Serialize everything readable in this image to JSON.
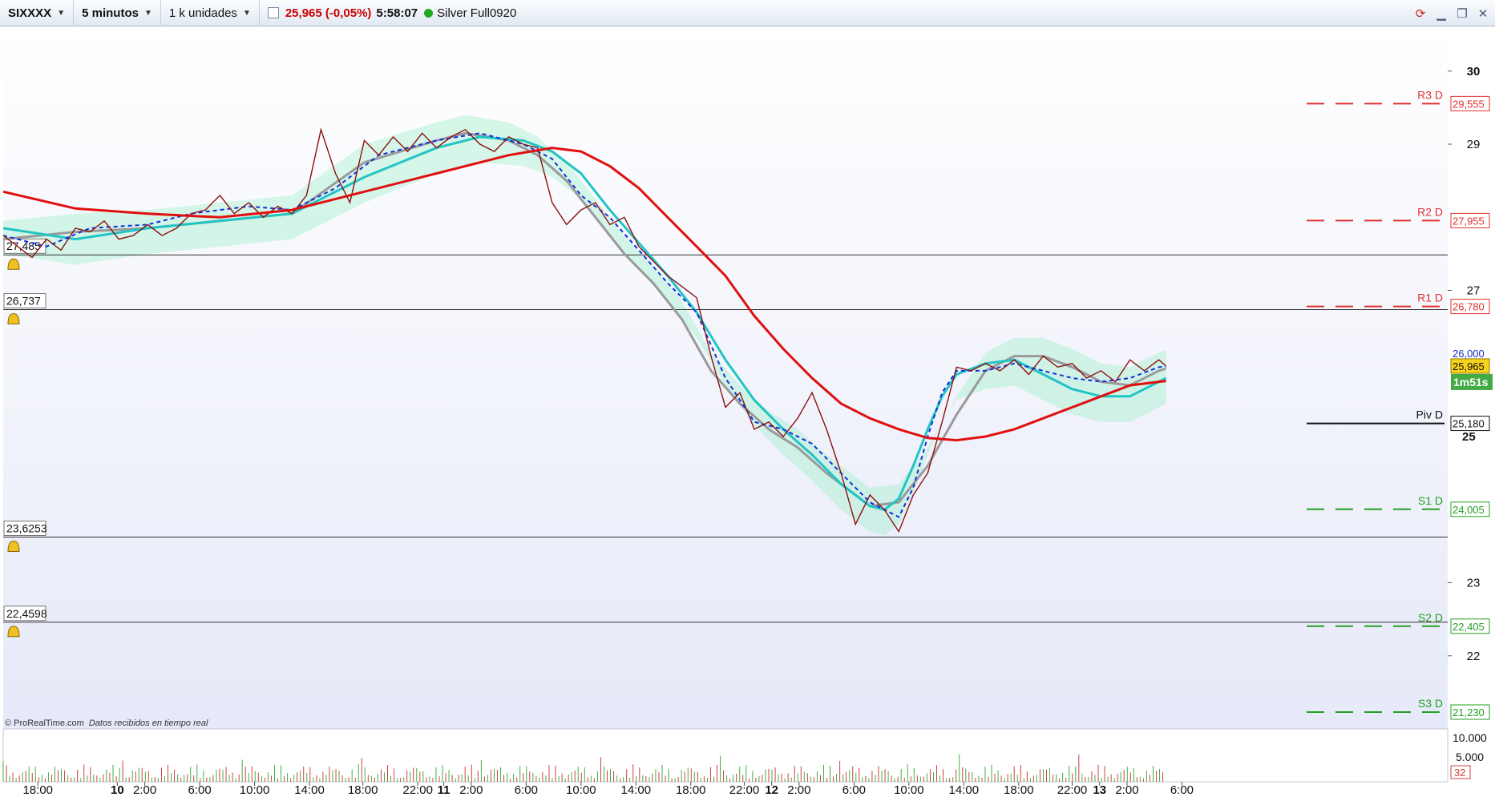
{
  "toolbar": {
    "instrument": "SIXXXX",
    "timeframe": "5 minutos",
    "quantity": "1 k unidades",
    "last_price": "25,965 (-0,05%)",
    "clock": "5:58:07",
    "account": "Silver Full0920"
  },
  "copyright": {
    "brand": "© ProRealTime.com",
    "note": "Datos recibidos en tiempo real"
  },
  "colors": {
    "price": "#8b1010",
    "ma_long": "#e01010",
    "ma_gray": "#9a9a9a",
    "ma_cyan": "#22c4c4",
    "kijun_blue": "#1030e0",
    "cloud": "#90eec0",
    "resistance": "#e03030",
    "support": "#22a022"
  },
  "price_axis": {
    "ticks": [
      "30",
      "29",
      "27",
      "23",
      "22"
    ],
    "bold_tick": "25",
    "range": [
      21.0,
      30.6
    ]
  },
  "horizontal_lines": [
    {
      "label": "27,485",
      "value": 27.485
    },
    {
      "label": "26,737",
      "value": 26.737
    },
    {
      "label": "23,6253",
      "value": 23.6253
    },
    {
      "label": "22,4598",
      "value": 22.4598
    }
  ],
  "pivots": [
    {
      "name": "R3 D",
      "label": "29,555",
      "value": 29.555,
      "kind": "resistance"
    },
    {
      "name": "R2 D",
      "label": "27,955",
      "value": 27.955,
      "kind": "resistance"
    },
    {
      "name": "R1 D",
      "label": "26,780",
      "value": 26.78,
      "kind": "resistance"
    },
    {
      "name": "Piv D",
      "label": "25,180",
      "value": 25.18,
      "kind": "pivot"
    },
    {
      "name": "S1 D",
      "label": "24,005",
      "value": 24.005,
      "kind": "support"
    },
    {
      "name": "S2 D",
      "label": "22,405",
      "value": 22.405,
      "kind": "support"
    },
    {
      "name": "S3 D",
      "label": "21,230",
      "value": 21.23,
      "kind": "support"
    }
  ],
  "last_price_tag": "25,965",
  "countdown_tag": "1m51s",
  "partial_tag": "26,000",
  "volume_axis": {
    "ticks": [
      "10.000",
      "5.000"
    ],
    "last_volume": "32"
  },
  "time_axis": [
    {
      "label": "18:00",
      "bold": false,
      "t": 0.024
    },
    {
      "label": "10",
      "bold": true,
      "t": 0.079
    },
    {
      "label": "2:00",
      "bold": false,
      "t": 0.098
    },
    {
      "label": "6:00",
      "bold": false,
      "t": 0.136
    },
    {
      "label": "10:00",
      "bold": false,
      "t": 0.174
    },
    {
      "label": "14:00",
      "bold": false,
      "t": 0.212
    },
    {
      "label": "18:00",
      "bold": false,
      "t": 0.249
    },
    {
      "label": "22:00",
      "bold": false,
      "t": 0.287
    },
    {
      "label": "11",
      "bold": true,
      "t": 0.305
    },
    {
      "label": "2:00",
      "bold": false,
      "t": 0.324
    },
    {
      "label": "6:00",
      "bold": false,
      "t": 0.362
    },
    {
      "label": "10:00",
      "bold": false,
      "t": 0.4
    },
    {
      "label": "14:00",
      "bold": false,
      "t": 0.438
    },
    {
      "label": "18:00",
      "bold": false,
      "t": 0.476
    },
    {
      "label": "22:00",
      "bold": false,
      "t": 0.513
    },
    {
      "label": "12",
      "bold": true,
      "t": 0.532
    },
    {
      "label": "2:00",
      "bold": false,
      "t": 0.551
    },
    {
      "label": "6:00",
      "bold": false,
      "t": 0.589
    },
    {
      "label": "10:00",
      "bold": false,
      "t": 0.627
    },
    {
      "label": "14:00",
      "bold": false,
      "t": 0.665
    },
    {
      "label": "18:00",
      "bold": false,
      "t": 0.703
    },
    {
      "label": "22:00",
      "bold": false,
      "t": 0.74
    },
    {
      "label": "13",
      "bold": true,
      "t": 0.759
    },
    {
      "label": "2:00",
      "bold": false,
      "t": 0.778
    },
    {
      "label": "6:00",
      "bold": false,
      "t": 0.816
    }
  ],
  "chart_data": {
    "type": "line",
    "series": [
      {
        "values": [
          [
            0.0,
            27.75
          ],
          [
            0.01,
            27.6
          ],
          [
            0.02,
            27.45
          ],
          [
            0.03,
            27.7
          ],
          [
            0.04,
            27.55
          ],
          [
            0.05,
            27.85
          ],
          [
            0.06,
            27.8
          ],
          [
            0.07,
            27.95
          ],
          [
            0.08,
            27.7
          ],
          [
            0.09,
            27.75
          ],
          [
            0.1,
            27.9
          ],
          [
            0.11,
            27.75
          ],
          [
            0.12,
            27.85
          ],
          [
            0.13,
            28.05
          ],
          [
            0.14,
            28.1
          ],
          [
            0.15,
            28.3
          ],
          [
            0.16,
            28.05
          ],
          [
            0.17,
            28.2
          ],
          [
            0.18,
            28.0
          ],
          [
            0.19,
            28.15
          ],
          [
            0.2,
            28.05
          ],
          [
            0.21,
            28.3
          ],
          [
            0.22,
            29.2
          ],
          [
            0.23,
            28.6
          ],
          [
            0.24,
            28.2
          ],
          [
            0.25,
            29.05
          ],
          [
            0.26,
            28.85
          ],
          [
            0.27,
            29.1
          ],
          [
            0.28,
            28.9
          ],
          [
            0.29,
            29.15
          ],
          [
            0.3,
            28.95
          ],
          [
            0.31,
            29.1
          ],
          [
            0.32,
            29.2
          ],
          [
            0.33,
            29.0
          ],
          [
            0.34,
            28.9
          ],
          [
            0.35,
            29.1
          ],
          [
            0.36,
            29.0
          ],
          [
            0.37,
            28.95
          ],
          [
            0.38,
            28.2
          ],
          [
            0.39,
            27.9
          ],
          [
            0.4,
            28.1
          ],
          [
            0.41,
            28.2
          ],
          [
            0.42,
            27.9
          ],
          [
            0.43,
            28.0
          ],
          [
            0.44,
            27.6
          ],
          [
            0.45,
            27.4
          ],
          [
            0.46,
            27.2
          ],
          [
            0.47,
            27.05
          ],
          [
            0.48,
            26.9
          ],
          [
            0.49,
            26.1
          ],
          [
            0.5,
            25.4
          ],
          [
            0.51,
            25.6
          ],
          [
            0.52,
            25.1
          ],
          [
            0.53,
            25.2
          ],
          [
            0.54,
            25.0
          ],
          [
            0.55,
            25.25
          ],
          [
            0.56,
            25.6
          ],
          [
            0.57,
            25.1
          ],
          [
            0.58,
            24.5
          ],
          [
            0.59,
            23.8
          ],
          [
            0.6,
            24.2
          ],
          [
            0.61,
            24.0
          ],
          [
            0.62,
            23.7
          ],
          [
            0.63,
            24.2
          ],
          [
            0.64,
            24.5
          ],
          [
            0.65,
            25.2
          ],
          [
            0.66,
            25.95
          ],
          [
            0.67,
            25.9
          ],
          [
            0.68,
            26.0
          ],
          [
            0.69,
            25.9
          ],
          [
            0.7,
            26.05
          ],
          [
            0.71,
            25.85
          ],
          [
            0.72,
            26.1
          ],
          [
            0.73,
            25.95
          ],
          [
            0.74,
            26.0
          ],
          [
            0.75,
            25.8
          ],
          [
            0.76,
            25.9
          ],
          [
            0.77,
            25.75
          ],
          [
            0.78,
            26.05
          ],
          [
            0.79,
            25.9
          ],
          [
            0.8,
            26.05
          ],
          [
            0.805,
            25.965
          ]
        ]
      }
    ],
    "ma_long": [
      [
        0.0,
        28.35
      ],
      [
        0.05,
        28.12
      ],
      [
        0.1,
        28.05
      ],
      [
        0.15,
        28.0
      ],
      [
        0.2,
        28.1
      ],
      [
        0.25,
        28.35
      ],
      [
        0.3,
        28.6
      ],
      [
        0.35,
        28.85
      ],
      [
        0.38,
        28.95
      ],
      [
        0.4,
        28.9
      ],
      [
        0.42,
        28.7
      ],
      [
        0.44,
        28.4
      ],
      [
        0.46,
        28.0
      ],
      [
        0.48,
        27.6
      ],
      [
        0.5,
        27.2
      ],
      [
        0.52,
        26.65
      ],
      [
        0.54,
        26.2
      ],
      [
        0.56,
        25.8
      ],
      [
        0.58,
        25.45
      ],
      [
        0.6,
        25.25
      ],
      [
        0.62,
        25.1
      ],
      [
        0.64,
        24.98
      ],
      [
        0.66,
        24.95
      ],
      [
        0.68,
        25.0
      ],
      [
        0.7,
        25.1
      ],
      [
        0.72,
        25.25
      ],
      [
        0.74,
        25.4
      ],
      [
        0.76,
        25.55
      ],
      [
        0.78,
        25.7
      ],
      [
        0.8,
        25.75
      ],
      [
        0.805,
        25.76
      ]
    ],
    "ma_gray": [
      [
        0.0,
        27.7
      ],
      [
        0.05,
        27.8
      ],
      [
        0.1,
        27.85
      ],
      [
        0.15,
        27.95
      ],
      [
        0.2,
        28.05
      ],
      [
        0.25,
        28.75
      ],
      [
        0.3,
        29.05
      ],
      [
        0.32,
        29.15
      ],
      [
        0.35,
        29.05
      ],
      [
        0.37,
        28.85
      ],
      [
        0.39,
        28.5
      ],
      [
        0.41,
        28.0
      ],
      [
        0.43,
        27.5
      ],
      [
        0.45,
        27.1
      ],
      [
        0.47,
        26.6
      ],
      [
        0.49,
        25.9
      ],
      [
        0.51,
        25.45
      ],
      [
        0.53,
        25.1
      ],
      [
        0.55,
        24.85
      ],
      [
        0.57,
        24.5
      ],
      [
        0.59,
        24.2
      ],
      [
        0.6,
        24.05
      ],
      [
        0.62,
        24.1
      ],
      [
        0.64,
        24.6
      ],
      [
        0.66,
        25.3
      ],
      [
        0.68,
        25.9
      ],
      [
        0.7,
        26.1
      ],
      [
        0.72,
        26.1
      ],
      [
        0.74,
        25.95
      ],
      [
        0.76,
        25.75
      ],
      [
        0.78,
        25.7
      ],
      [
        0.8,
        25.9
      ],
      [
        0.805,
        25.93
      ]
    ],
    "ma_cyan": [
      [
        0.0,
        27.85
      ],
      [
        0.05,
        27.7
      ],
      [
        0.1,
        27.85
      ],
      [
        0.15,
        27.95
      ],
      [
        0.2,
        28.05
      ],
      [
        0.25,
        28.55
      ],
      [
        0.3,
        28.95
      ],
      [
        0.33,
        29.1
      ],
      [
        0.36,
        29.05
      ],
      [
        0.38,
        28.9
      ],
      [
        0.4,
        28.6
      ],
      [
        0.42,
        28.1
      ],
      [
        0.44,
        27.65
      ],
      [
        0.46,
        27.2
      ],
      [
        0.48,
        26.7
      ],
      [
        0.5,
        26.05
      ],
      [
        0.52,
        25.5
      ],
      [
        0.54,
        25.1
      ],
      [
        0.56,
        24.75
      ],
      [
        0.58,
        24.35
      ],
      [
        0.6,
        24.05
      ],
      [
        0.61,
        24.0
      ],
      [
        0.62,
        24.15
      ],
      [
        0.63,
        24.6
      ],
      [
        0.64,
        25.1
      ],
      [
        0.65,
        25.55
      ],
      [
        0.66,
        25.85
      ],
      [
        0.68,
        26.0
      ],
      [
        0.7,
        26.05
      ],
      [
        0.72,
        25.85
      ],
      [
        0.74,
        25.65
      ],
      [
        0.76,
        25.55
      ],
      [
        0.78,
        25.55
      ],
      [
        0.8,
        25.75
      ],
      [
        0.805,
        25.8
      ]
    ],
    "kijun_blue": [
      [
        0.0,
        27.75
      ],
      [
        0.03,
        27.6
      ],
      [
        0.06,
        27.85
      ],
      [
        0.1,
        27.9
      ],
      [
        0.13,
        28.05
      ],
      [
        0.17,
        28.15
      ],
      [
        0.2,
        28.1
      ],
      [
        0.23,
        28.4
      ],
      [
        0.26,
        28.85
      ],
      [
        0.3,
        29.05
      ],
      [
        0.33,
        29.15
      ],
      [
        0.36,
        29.0
      ],
      [
        0.38,
        28.8
      ],
      [
        0.4,
        28.3
      ],
      [
        0.42,
        28.0
      ],
      [
        0.44,
        27.55
      ],
      [
        0.46,
        27.1
      ],
      [
        0.48,
        26.7
      ],
      [
        0.5,
        25.8
      ],
      [
        0.52,
        25.2
      ],
      [
        0.54,
        25.1
      ],
      [
        0.56,
        24.9
      ],
      [
        0.58,
        24.5
      ],
      [
        0.6,
        24.1
      ],
      [
        0.62,
        23.9
      ],
      [
        0.63,
        24.3
      ],
      [
        0.64,
        25.0
      ],
      [
        0.65,
        25.6
      ],
      [
        0.66,
        25.9
      ],
      [
        0.68,
        25.9
      ],
      [
        0.7,
        26.0
      ],
      [
        0.72,
        25.9
      ],
      [
        0.74,
        25.8
      ],
      [
        0.76,
        25.75
      ],
      [
        0.78,
        25.8
      ],
      [
        0.8,
        25.95
      ],
      [
        0.805,
        25.96
      ]
    ]
  }
}
